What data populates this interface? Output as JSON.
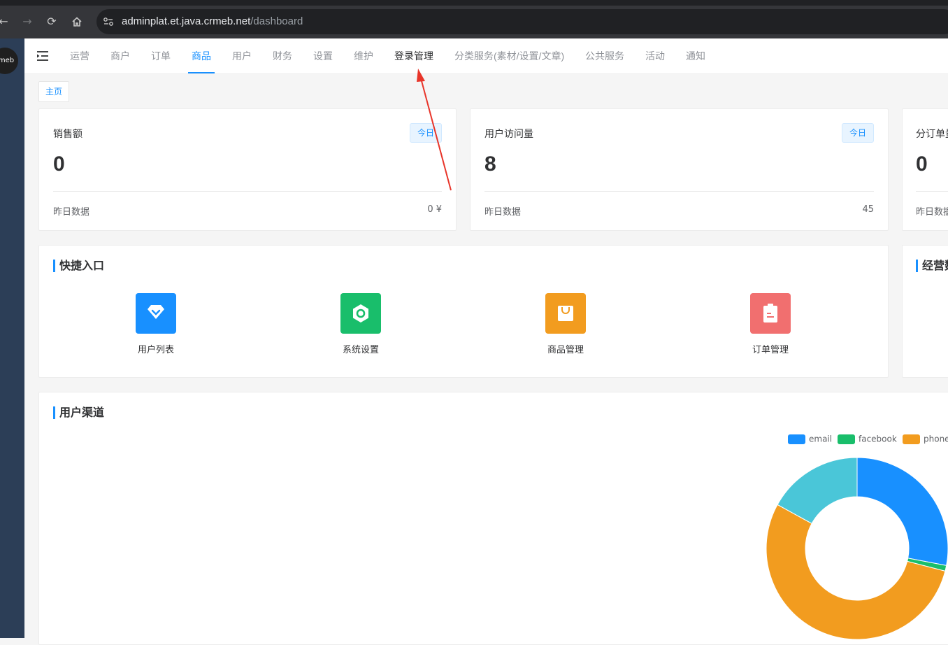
{
  "browser": {
    "url_host": "adminplat.et.java.crmeb.net",
    "url_path": "/dashboard"
  },
  "sidebar": {
    "logo_text": "rmeb"
  },
  "topnav": {
    "items": [
      {
        "label": "运营"
      },
      {
        "label": "商户"
      },
      {
        "label": "订单"
      },
      {
        "label": "商品",
        "active": true
      },
      {
        "label": "用户"
      },
      {
        "label": "财务"
      },
      {
        "label": "设置"
      },
      {
        "label": "维护"
      },
      {
        "label": "登录管理"
      },
      {
        "label": "分类服务(素材/设置/文章)"
      },
      {
        "label": "公共服务"
      },
      {
        "label": "活动"
      },
      {
        "label": "通知"
      }
    ]
  },
  "breadcrumb": {
    "home": "主页"
  },
  "stats": [
    {
      "title": "销售额",
      "tag": "今日",
      "value": "0",
      "foot_label": "昨日数据",
      "foot_value": "0 ¥"
    },
    {
      "title": "用户访问量",
      "tag": "今日",
      "value": "8",
      "foot_label": "昨日数据",
      "foot_value": "45"
    },
    {
      "title": "分订单量",
      "value": "0",
      "foot_label": "昨日数据"
    }
  ],
  "quick_entry": {
    "title": "快捷入口",
    "items": [
      {
        "label": "用户列表",
        "color": "#1890ff",
        "icon": "diamond-icon"
      },
      {
        "label": "系统设置",
        "color": "#19be6b",
        "icon": "settings-hex-icon"
      },
      {
        "label": "商品管理",
        "color": "#f29c1f",
        "icon": "shopping-bag-icon"
      },
      {
        "label": "订单管理",
        "color": "#f16f6f",
        "icon": "clipboard-icon"
      }
    ]
  },
  "business_panel": {
    "title": "经营数"
  },
  "user_channel": {
    "title": "用户渠道"
  },
  "chart_data": {
    "type": "pie",
    "legend_position": "top-right",
    "series": [
      {
        "name": "email",
        "color": "#1890ff",
        "value": 28
      },
      {
        "name": "facebook",
        "color": "#19be6b",
        "value": 1
      },
      {
        "name": "phone",
        "color": "#f29c1f",
        "value": 54
      },
      {
        "name": "",
        "color": "#4ac6d8",
        "value": 17
      }
    ]
  }
}
